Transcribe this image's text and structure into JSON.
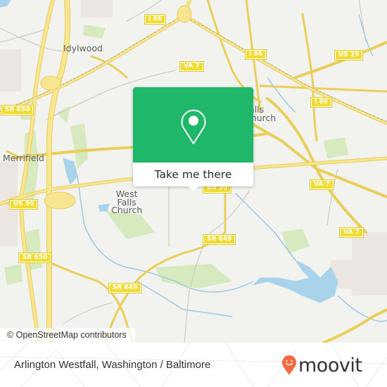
{
  "map": {
    "places": [
      {
        "id": "idylwood",
        "name": "Idylwood"
      },
      {
        "id": "merrifield",
        "name": "Merrifield"
      },
      {
        "id": "west-falls-church",
        "name": "West\nFalls\nChurch"
      },
      {
        "id": "falls-church",
        "name": "Falls\nChurch"
      }
    ],
    "shields": [
      {
        "id": "i66-a",
        "label": "I 66"
      },
      {
        "id": "i66-b",
        "label": "I 66"
      },
      {
        "id": "i66-c",
        "label": "I 66"
      },
      {
        "id": "us29",
        "label": "US 29"
      },
      {
        "id": "va7-a",
        "label": "VA 7"
      },
      {
        "id": "va7-b",
        "label": "VA 7"
      },
      {
        "id": "va7-c",
        "label": "VA 7"
      },
      {
        "id": "sr650-a",
        "label": "SR 650"
      },
      {
        "id": "sr650-b",
        "label": "SR 650"
      },
      {
        "id": "us50-a",
        "label": "US 50"
      },
      {
        "id": "us50-b",
        "label": "US 50"
      },
      {
        "id": "sr649-a",
        "label": "SR 649"
      },
      {
        "id": "sr649-b",
        "label": "SR 649"
      }
    ],
    "attribution": "© OpenStreetMap contributors",
    "colors": {
      "road": "#f6e07a",
      "water": "#a9d3ea",
      "park": "#cfe6b4",
      "land": "#f2f2ee"
    }
  },
  "popup": {
    "button_label": "Take me there",
    "icon": "map-pin-icon",
    "color": "#1fb769"
  },
  "footer": {
    "caption": "Arlington Westfall, Washington / Baltimore",
    "brand": "moovit",
    "brand_color": "#f26a3d"
  }
}
